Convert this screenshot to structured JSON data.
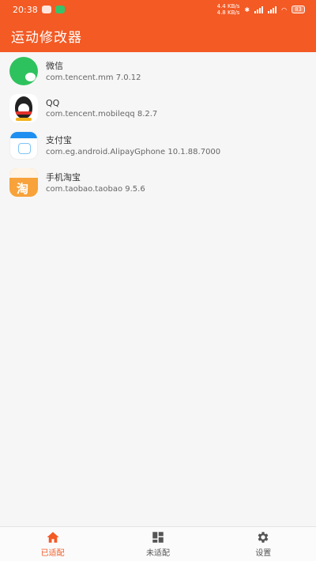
{
  "status_bar": {
    "time": "20:38",
    "network_top": "4.4 KB/s",
    "network_bottom": "4.8 KB/s",
    "battery": "83"
  },
  "app_bar": {
    "title": "运动修改器"
  },
  "apps": [
    {
      "name": "微信",
      "package": "com.tencent.mm 7.0.12",
      "icon": "wechat-icon"
    },
    {
      "name": "QQ",
      "package": "com.tencent.mobileqq 8.2.7",
      "icon": "qq-icon"
    },
    {
      "name": "支付宝",
      "package": "com.eg.android.AlipayGphone 10.1.88.7000",
      "icon": "alipay-icon"
    },
    {
      "name": "手机淘宝",
      "package": "com.taobao.taobao 9.5.6",
      "icon": "taobao-icon"
    }
  ],
  "bottom_nav": {
    "tabs": [
      {
        "label": "已适配",
        "icon": "home-icon",
        "active": true
      },
      {
        "label": "未适配",
        "icon": "grid-icon",
        "active": false
      },
      {
        "label": "设置",
        "icon": "gear-icon",
        "active": false
      }
    ]
  },
  "colors": {
    "accent": "#f35a24",
    "background": "#f6f6f6"
  }
}
